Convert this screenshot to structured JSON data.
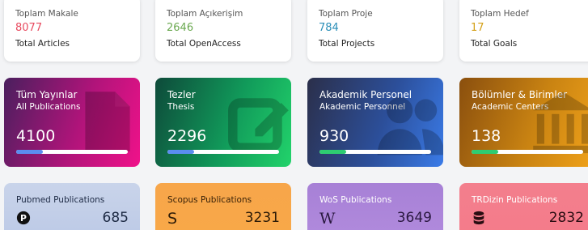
{
  "stats": [
    {
      "label": "Toplam Makale",
      "value": "8077",
      "sub": "Total Articles",
      "color": "#e84a5f"
    },
    {
      "label": "Toplam Açıkerişim",
      "value": "2646",
      "sub": "Total OpenAccess",
      "color": "#6aa84f"
    },
    {
      "label": "Toplam Proje",
      "value": "784",
      "sub": "Total Projects",
      "color": "#2b8fb8"
    },
    {
      "label": "Toplam Hedef",
      "value": "17",
      "sub": "Total Goals",
      "color": "#d4a017"
    }
  ],
  "cards": [
    {
      "title": "Tüm Yayınlar",
      "subtitle": "All Publications",
      "value": "4100",
      "progress": 0.24,
      "fill_color": "#5b8def",
      "icon": "document-icon"
    },
    {
      "title": "Tezler",
      "subtitle": "Thesis",
      "value": "2296",
      "progress": 0.24,
      "fill_color": "#5b8def",
      "icon": "edit-icon"
    },
    {
      "title": "Akademik Personel",
      "subtitle": "Akademic Personnel",
      "value": "930",
      "progress": 0.24,
      "fill_color": "#2ecc71",
      "icon": "users-icon"
    },
    {
      "title": "Bölümler & Birimler",
      "subtitle": "Academic Centers",
      "value": "138",
      "progress": 0.24,
      "fill_color": "#2ecc71",
      "icon": "building-icon"
    }
  ],
  "dbs": [
    {
      "label": "Pubmed Publications",
      "count": "685",
      "icon": "pubmed-icon"
    },
    {
      "label": "Scopus Publications",
      "count": "3231",
      "icon_text": "S",
      "icon": "scopus-icon"
    },
    {
      "label": "WoS Publications",
      "count": "3649",
      "icon_text": "W",
      "icon": "wos-icon"
    },
    {
      "label": "TRDizin Publications",
      "count": "2832",
      "icon": "database-icon"
    }
  ]
}
